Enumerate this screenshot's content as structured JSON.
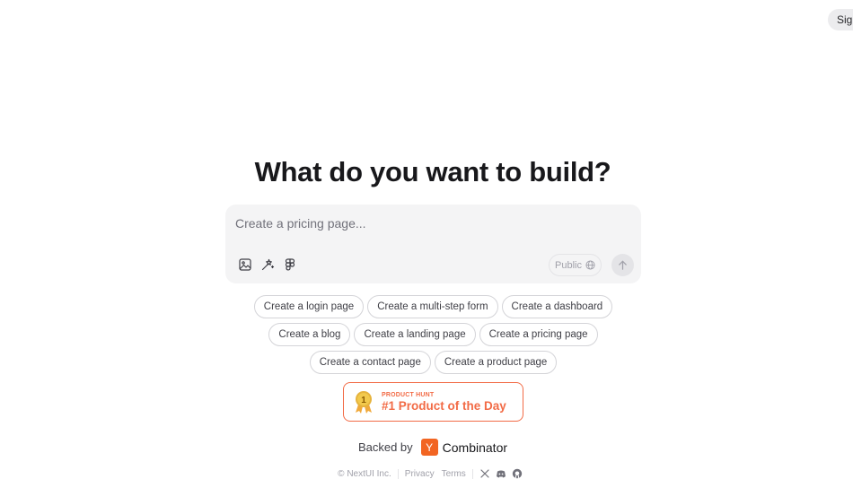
{
  "header": {
    "sign_in_label": "Sign in"
  },
  "hero": {
    "title": "What do you want to build?"
  },
  "prompt": {
    "value": "",
    "placeholder": "Create a pricing page...",
    "tools": [
      "image-icon",
      "wand-icon",
      "figma-icon"
    ],
    "visibility_label": "Public",
    "send_icon": "arrow-up-icon"
  },
  "suggestions": {
    "rows": [
      [
        "Create a login page",
        "Create a multi-step form",
        "Create a dashboard"
      ],
      [
        "Create a blog",
        "Create a landing page",
        "Create a pricing page"
      ],
      [
        "Create a contact page",
        "Create a product page"
      ]
    ]
  },
  "product_hunt": {
    "eyebrow": "PRODUCT HUNT",
    "title": "#1 Product of the Day",
    "medal_number": "1",
    "color": "#f26b46"
  },
  "backed_by": {
    "label": "Backed by",
    "logo_letter": "Y",
    "name": "Combinator",
    "logo_color": "#f26522"
  },
  "footer": {
    "copyright": "© NextUI Inc.",
    "privacy": "Privacy",
    "terms": "Terms",
    "social_icons": [
      "x-icon",
      "discord-icon",
      "github-icon"
    ]
  }
}
